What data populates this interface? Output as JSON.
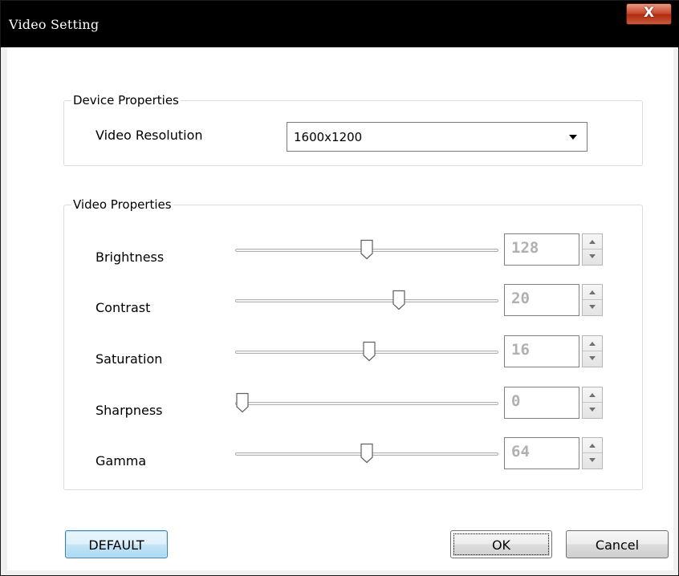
{
  "window": {
    "title": "Video Setting",
    "close_label": "X"
  },
  "device_properties": {
    "caption": "Device Properties",
    "resolution_label": "Video Resolution",
    "resolution_value": "1600x1200"
  },
  "video_properties": {
    "caption": "Video Properties",
    "items": [
      {
        "label": "Brightness",
        "value": "128",
        "slider_fraction": 0.5
      },
      {
        "label": "Contrast",
        "value": "20",
        "slider_fraction": 0.63
      },
      {
        "label": "Saturation",
        "value": "16",
        "slider_fraction": 0.51
      },
      {
        "label": "Sharpness",
        "value": "0",
        "slider_fraction": 0.0
      },
      {
        "label": "Gamma",
        "value": "64",
        "slider_fraction": 0.5
      }
    ]
  },
  "buttons": {
    "default_label": "DEFAULT",
    "ok_label": "OK",
    "cancel_label": "Cancel"
  },
  "colors": {
    "titlebar": "#000000",
    "close_button": "#c8472c",
    "default_button_accent": "#3c7fb1",
    "disabled_value_text": "#b0b0b0"
  }
}
